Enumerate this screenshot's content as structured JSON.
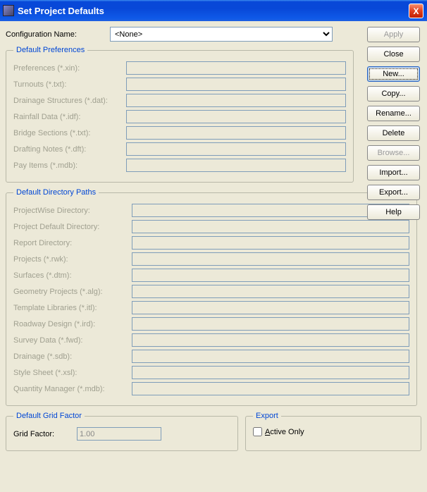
{
  "window": {
    "title": "Set Project Defaults",
    "close_x": "X"
  },
  "config": {
    "label": "Configuration Name:",
    "value": "<None>"
  },
  "buttons": {
    "apply": "Apply",
    "close": "Close",
    "new_": "New...",
    "copy": "Copy...",
    "rename": "Rename...",
    "delete": "Delete",
    "browse": "Browse...",
    "import_": "Import...",
    "export_": "Export...",
    "help": "Help"
  },
  "prefs": {
    "legend": "Default Preferences",
    "rows": [
      {
        "label": "Preferences (*.xin):",
        "value": ""
      },
      {
        "label": "Turnouts (*.txt):",
        "value": ""
      },
      {
        "label": "Drainage Structures (*.dat):",
        "value": ""
      },
      {
        "label": "Rainfall Data (*.idf):",
        "value": ""
      },
      {
        "label": "Bridge Sections (*.txt):",
        "value": ""
      },
      {
        "label": "Drafting Notes (*.dft):",
        "value": ""
      },
      {
        "label": "Pay Items (*.mdb):",
        "value": ""
      }
    ]
  },
  "dirs": {
    "legend": "Default Directory Paths",
    "rows": [
      {
        "label": "ProjectWise Directory:",
        "value": ""
      },
      {
        "label": "Project Default Directory:",
        "value": ""
      },
      {
        "label": "Report Directory:",
        "value": ""
      },
      {
        "label": "Projects (*.rwk):",
        "value": ""
      },
      {
        "label": "Surfaces (*.dtm):",
        "value": ""
      },
      {
        "label": "Geometry Projects (*.alg):",
        "value": ""
      },
      {
        "label": "Template Libraries (*.itl):",
        "value": ""
      },
      {
        "label": "Roadway Design (*.ird):",
        "value": ""
      },
      {
        "label": "Survey Data (*.fwd):",
        "value": ""
      },
      {
        "label": "Drainage (*.sdb):",
        "value": ""
      },
      {
        "label": "Style Sheet (*.xsl):",
        "value": ""
      },
      {
        "label": "Quantity Manager (*.mdb):",
        "value": ""
      }
    ]
  },
  "grid": {
    "legend": "Default Grid Factor",
    "label": "Grid Factor:",
    "value": "1.00"
  },
  "export": {
    "legend": "Export",
    "active_only": "ctive Only",
    "active_only_prefix": "A",
    "checked": false
  }
}
